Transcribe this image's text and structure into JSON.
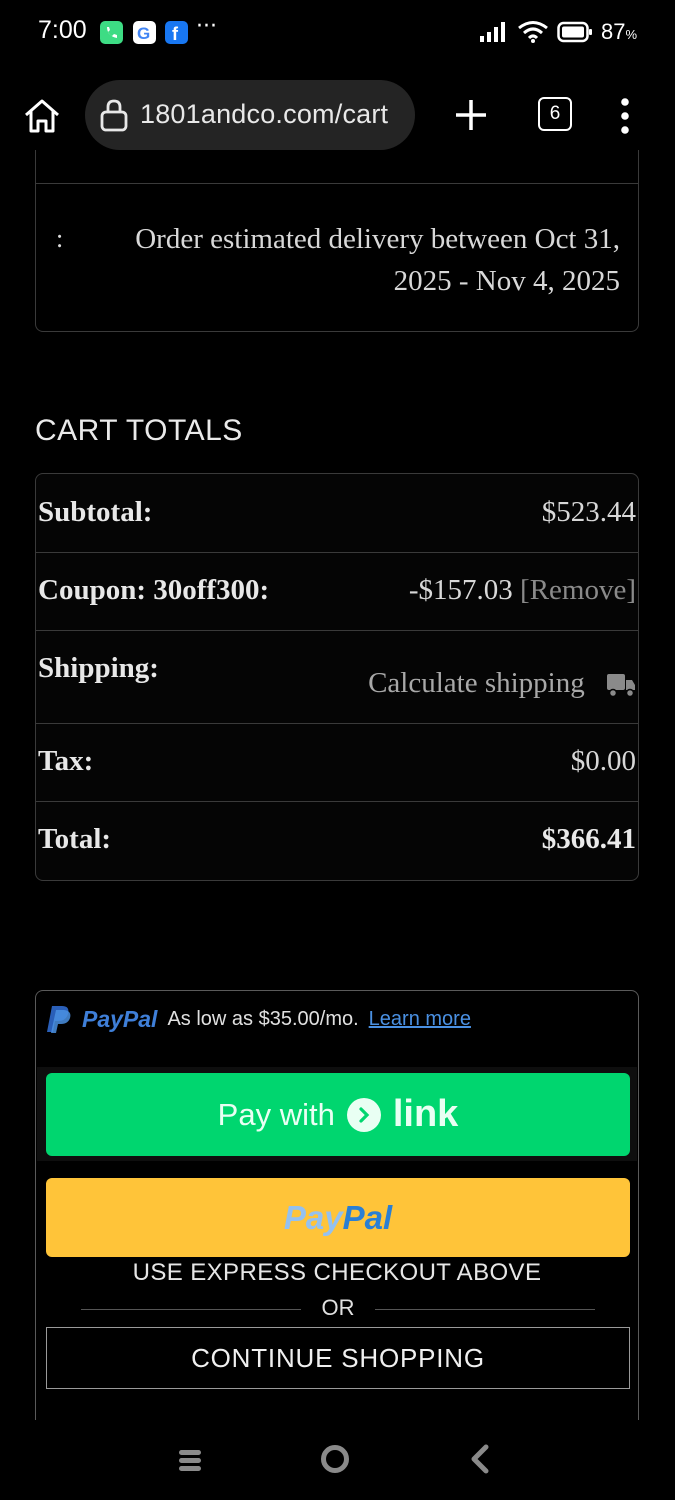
{
  "status_bar": {
    "time": "7:00",
    "more_indicator": "···",
    "battery": "87",
    "battery_unit": "%",
    "notification_icons": [
      "phone-app-icon",
      "google-icon",
      "facebook-icon"
    ]
  },
  "browser": {
    "url": "1801andco.com/cart",
    "tab_count": "6"
  },
  "delivery": {
    "colon": ":",
    "text": "Order estimated delivery between Oct 31, 2025 - Nov 4, 2025"
  },
  "cart_totals": {
    "title": "CART TOTALS",
    "subtotal_label": "Subtotal:",
    "subtotal_value": "$523.44",
    "coupon_label": "Coupon: 30off300:",
    "coupon_value": "-$157.03",
    "coupon_remove": "[Remove]",
    "shipping_label": "Shipping:",
    "shipping_value": "Calculate shipping",
    "tax_label": "Tax:",
    "tax_value": "$0.00",
    "total_label": "Total:",
    "total_value": "$366.41"
  },
  "checkout": {
    "paypal_brand": "PayPal",
    "paypal_message": "As low as $35.00/mo.",
    "paypal_learn_more": "Learn more",
    "link_pay_with": "Pay with",
    "link_brand": "link",
    "paypal_btn_pay": "Pay",
    "paypal_btn_pal": "Pal",
    "express_label": "USE EXPRESS CHECKOUT ABOVE",
    "or_label": "OR",
    "continue_label": "CONTINUE SHOPPING"
  },
  "colors": {
    "background": "#000000",
    "link_green": "#00d66f",
    "paypal_yellow": "#ffc439",
    "paypal_blue": "#2a7fd4",
    "learn_more_blue": "#4a90e2"
  }
}
